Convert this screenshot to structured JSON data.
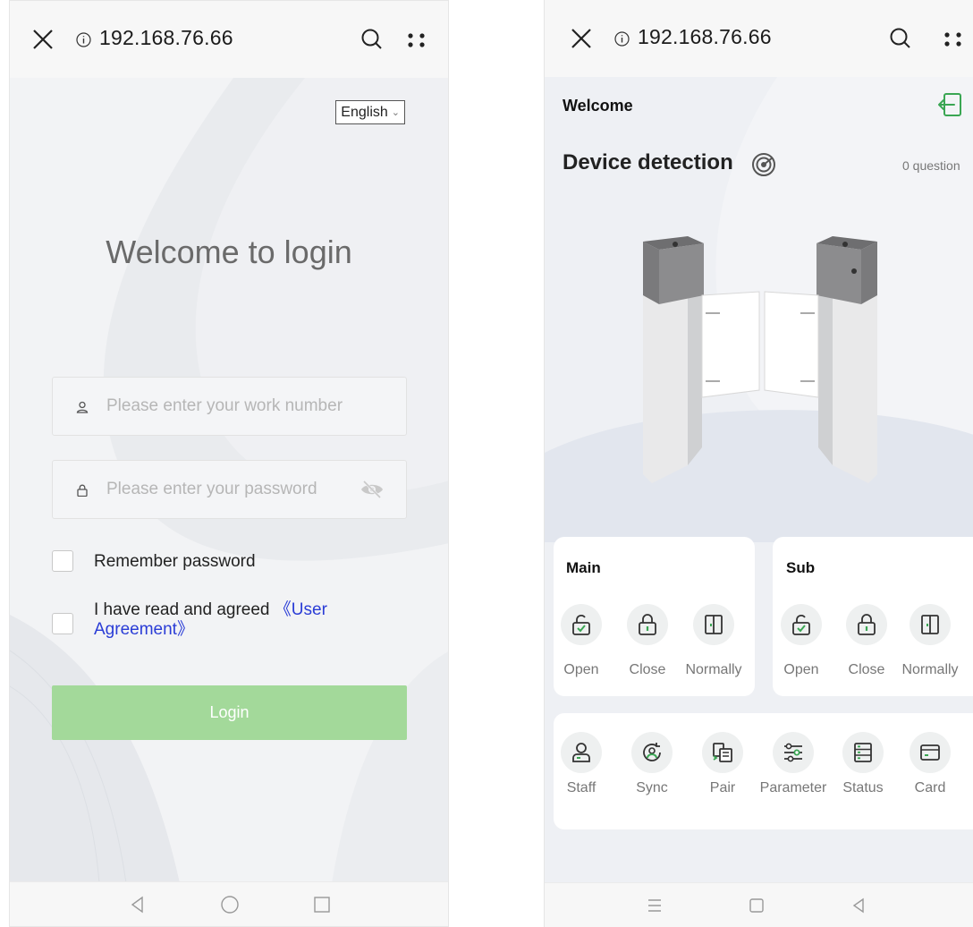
{
  "left_screen": {
    "browser": {
      "url": "192.168.76.66"
    },
    "language_select": {
      "value": "English"
    },
    "title": "Welcome to login",
    "work_number_field": {
      "placeholder": "Please enter your work number",
      "value": ""
    },
    "password_field": {
      "placeholder": "Please enter your password",
      "value": ""
    },
    "remember_password": {
      "label": "Remember password",
      "checked": false
    },
    "agreement": {
      "label": "I have read and agreed",
      "link": "《User Agreement》",
      "checked": false
    },
    "login_button": {
      "label": "Login",
      "color": "#a3d99a"
    }
  },
  "right_screen": {
    "browser": {
      "url": "192.168.76.66"
    },
    "header": {
      "welcome": "Welcome"
    },
    "device_detection": {
      "title": "Device detection",
      "questions": "0 question"
    },
    "main_card": {
      "title": "Main",
      "buttons": [
        {
          "label": "Open",
          "icon": "unlock-icon"
        },
        {
          "label": "Close",
          "icon": "lock-icon"
        },
        {
          "label": "Normally",
          "icon": "door-icon"
        }
      ]
    },
    "sub_card": {
      "title": "Sub",
      "buttons": [
        {
          "label": "Open",
          "icon": "unlock-icon"
        },
        {
          "label": "Close",
          "icon": "lock-icon"
        },
        {
          "label": "Normally",
          "icon": "door-icon"
        }
      ]
    },
    "tools_card": {
      "buttons": [
        {
          "label": "Staff",
          "icon": "staff-icon"
        },
        {
          "label": "Sync",
          "icon": "sync-icon"
        },
        {
          "label": "Pair",
          "icon": "pair-icon"
        },
        {
          "label": "Parameter",
          "icon": "parameter-icon"
        },
        {
          "label": "Status",
          "icon": "status-icon"
        },
        {
          "label": "Card",
          "icon": "card-icon"
        }
      ]
    },
    "accent_color": "#3aa653"
  }
}
